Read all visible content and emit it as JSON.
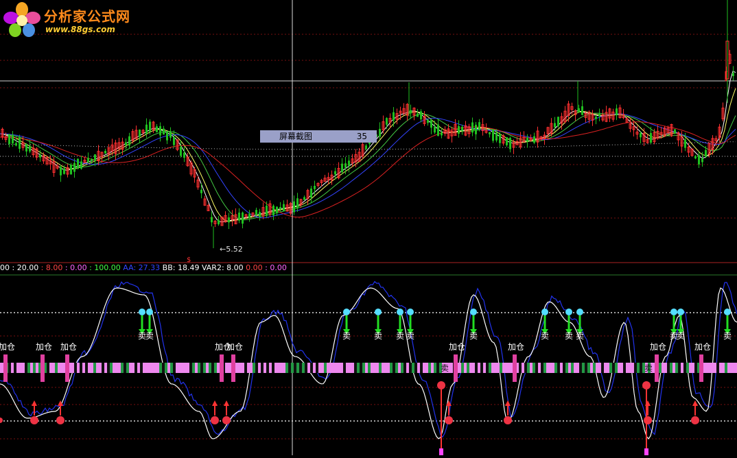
{
  "logo": {
    "title": "分析家公式网",
    "url": "www.88gs.com"
  },
  "tooltip": {
    "label": "屏幕截图",
    "value": "35"
  },
  "low_label": "5.52",
  "indicator_bar": [
    {
      "text": "00 : 20.00",
      "color": "#ffffff"
    },
    {
      "text": " : 8.00",
      "color": "#ff4444"
    },
    {
      "text": " : 0.00",
      "color": "#ff66ff"
    },
    {
      "text": " : 100.00",
      "color": "#44ff44"
    },
    {
      "text": " AA: 27.33",
      "color": "#3344ff"
    },
    {
      "text": " BB: 18.49",
      "color": "#ffffff"
    },
    {
      "text": "   VAR2: 8.00",
      "color": "#ffffff"
    },
    {
      "text": "  0.00",
      "color": "#ff4444"
    },
    {
      "text": "   : 0.00",
      "color": "#ff66ff"
    }
  ],
  "signals": {
    "add_label": "加仓",
    "sell_label": "卖"
  },
  "chart_data": [
    {
      "type": "candlestick",
      "low_marker": 5.52,
      "series": [
        {
          "name": "",
          "color": "#ffffff"
        },
        {
          "name": "",
          "color": "#ffff66"
        },
        {
          "name": "",
          "color": "#44cc44"
        },
        {
          "name": "",
          "color": "#3344ff"
        },
        {
          "name": "",
          "color": "#dd2222"
        }
      ]
    },
    {
      "type": "line",
      "ref_lines": [
        0,
        20,
        100
      ],
      "series": [
        {
          "name": "AA",
          "color": "#3344ff",
          "last": 27.33
        },
        {
          "name": "BB",
          "color": "#ffffff",
          "last": 18.49
        }
      ]
    }
  ],
  "colors": {
    "up": "#ff3030",
    "down": "#20c020",
    "band_pink": "#ee88ee",
    "band_green": "#229944",
    "grid_red": "#7a1010",
    "crosshair": "#dddddd"
  }
}
